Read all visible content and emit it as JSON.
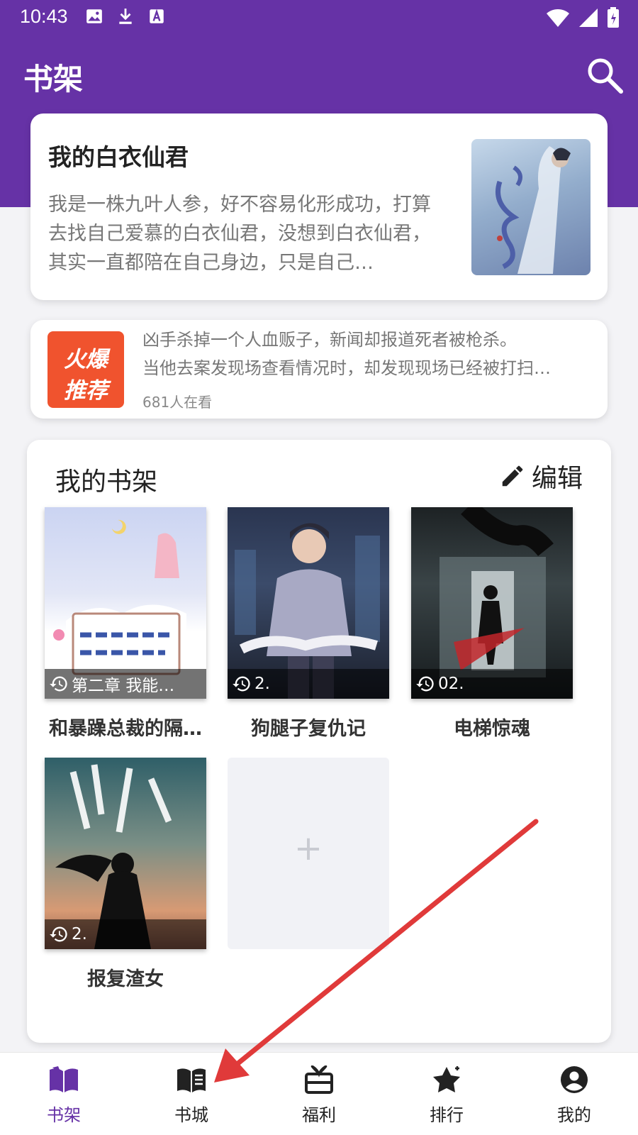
{
  "status_bar": {
    "time": "10:43"
  },
  "header": {
    "title": "书架"
  },
  "featured": {
    "title": "我的白衣仙君",
    "description": "我是一株九叶人参，好不容易化形成功，打算去找自己爱慕的白衣仙君，没想到白衣仙君，其实一直都陪在自己身边，只是自己…"
  },
  "promo": {
    "badge_line1": "火爆",
    "badge_line2": "推荐",
    "line1": "凶手杀掉一个人血贩子，新闻却报道死者被枪杀。",
    "line2": "当他去案发现场查看情况时，却发现现场已经被打扫…",
    "viewers": "681人在看"
  },
  "shelf": {
    "title": "我的书架",
    "edit_label": "编辑",
    "books": [
      {
        "title": "和暴躁总裁的隔…",
        "progress": "第二章 我能…"
      },
      {
        "title": "狗腿子复仇记",
        "progress": "2."
      },
      {
        "title": "电梯惊魂",
        "progress": "02."
      },
      {
        "title": "报复渣女",
        "progress": "2."
      }
    ],
    "add_symbol": "+"
  },
  "bottom_nav": {
    "items": [
      {
        "label": "书架",
        "icon": "open-book-icon",
        "active": true
      },
      {
        "label": "书城",
        "icon": "book-icon",
        "active": false
      },
      {
        "label": "福利",
        "icon": "gift-icon",
        "active": false
      },
      {
        "label": "排行",
        "icon": "star-rank-icon",
        "active": false
      },
      {
        "label": "我的",
        "icon": "person-icon",
        "active": false
      }
    ]
  },
  "colors": {
    "brand": "#6632a6",
    "promo_badge": "#f0532e",
    "annotation_arrow": "#e03a3a"
  }
}
